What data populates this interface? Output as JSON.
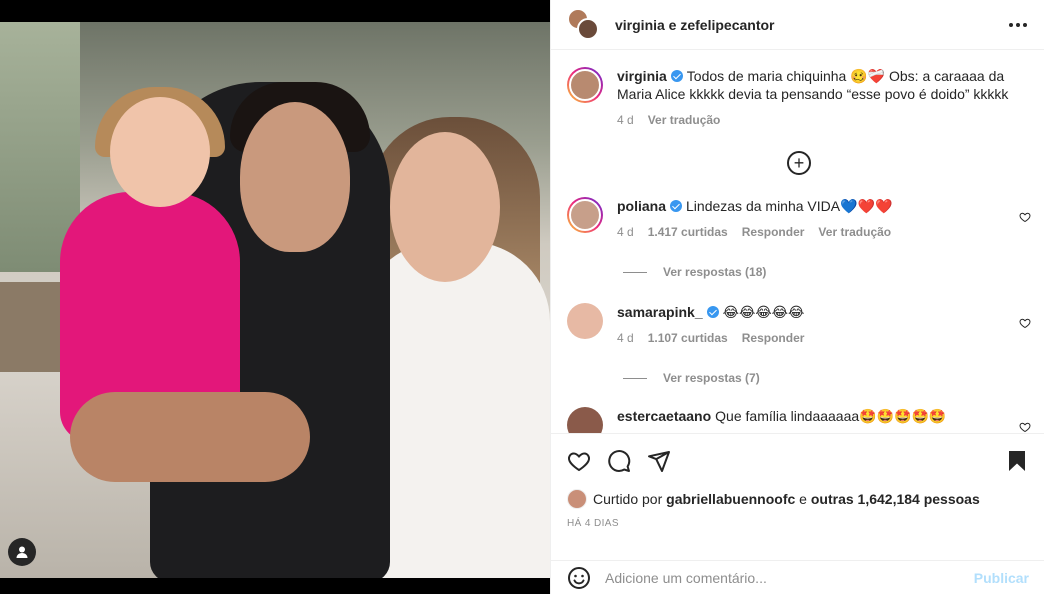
{
  "post": {
    "header": {
      "title": "virginia e zefelipecantor",
      "more_icon": "more-horizontal-icon"
    },
    "image": {
      "user_tag_icon": "person-icon"
    }
  },
  "caption": {
    "username": "virginia",
    "text": "Todos de maria chiquinha 🥴❤️‍🩹 Obs: a caraaaa da Maria Alice kkkkk devia ta pensando “esse povo é doido” kkkkk",
    "time": "4 d",
    "translate": "Ver tradução"
  },
  "load_more_icon": "plus-circle-icon",
  "comments": [
    {
      "username": "poliana",
      "text": "Lindezas da minha VIDA💙❤️❤️",
      "time": "4 d",
      "likes": "1.417 curtidas",
      "reply": "Responder",
      "translate": "Ver tradução",
      "view_replies": "Ver respostas (18)",
      "colors": {
        "avatar": "#c79f8a"
      }
    },
    {
      "username": "samarapink_",
      "text": "😂😂😂😂😂",
      "time": "4 d",
      "likes": "1.107 curtidas",
      "reply": "Responder",
      "view_replies": "Ver respostas (7)",
      "colors": {
        "avatar": "#e7b9a4"
      }
    },
    {
      "username": "estercaetaano",
      "text": "Que família lindaaaaaa🤩🤩🤩🤩🤩",
      "colors": {
        "avatar": "#8a5a4a"
      }
    }
  ],
  "actions": {
    "like_icon": "heart-icon",
    "comment_icon": "comment-icon",
    "share_icon": "send-icon",
    "save_icon": "bookmark-icon"
  },
  "likes": {
    "prefix": "Curtido por",
    "user": "gabriellabuennoofc",
    "joiner": "e",
    "others": "outras 1,642,184 pessoas"
  },
  "timestamp": "HÁ 4 DIAS",
  "add_comment": {
    "emoji_icon": "emoji-icon",
    "placeholder": "Adicione um comentário...",
    "publish": "Publicar"
  },
  "colors": {
    "publish": "#b2dffc",
    "verified": "#3897f0",
    "muted": "#8e8e8e"
  }
}
